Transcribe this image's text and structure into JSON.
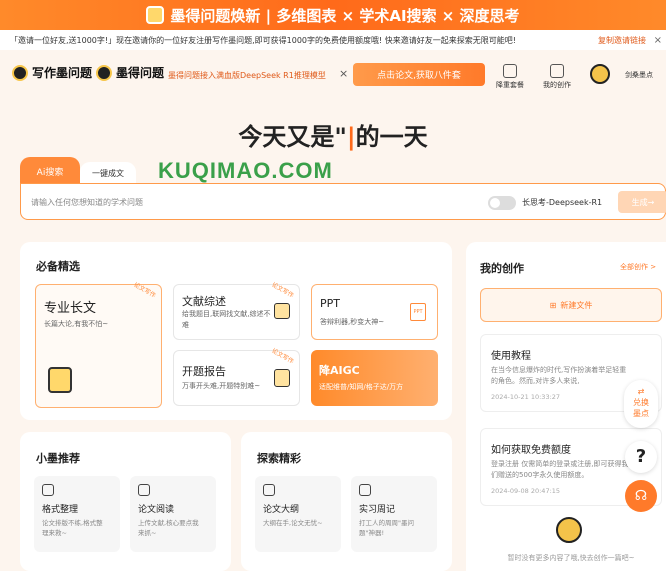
{
  "banner": {
    "text": "墨得问题焕新 | 多维图表 × 学术AI搜索 × 深度思考"
  },
  "invite": {
    "text": "「邀请一位好友,送1000字!」现在邀请你的一位好友注册写作墨问题,即可获得1000字的免费使用额度哦! 快来邀请好友一起来探索无限可能吧!",
    "copy_label": "复制邀请链接",
    "close": "×"
  },
  "header": {
    "logo": "写作墨问题",
    "logo2": "墨得问题",
    "notice": "墨得问题接入满血版DeepSeek R1推理模型",
    "notice_close": "×",
    "cta": "点击论文,获取八件套",
    "nav": [
      "降重套餐",
      "我的创作"
    ],
    "user": "剑桑墨点"
  },
  "hero": {
    "prefix": "今天又是\"",
    "cursor": "|",
    "suffix": "的一天"
  },
  "search": {
    "tab_active": "Ai搜索",
    "tab2": "一键成文",
    "watermark": "KUQIMAO.COM",
    "placeholder": "请输入任何您想知道的学术问题",
    "model": "长思考-Deepseek-R1",
    "generate": "生成→"
  },
  "essentials": {
    "title": "必备精选",
    "cards": [
      {
        "title": "专业长文",
        "sub": "长篇大论,有我不怕~",
        "badge": "论文写作"
      },
      {
        "title": "文献综述",
        "sub": "给我题目,联网找文献,综述不难",
        "badge": "论文写作"
      },
      {
        "title": "PPT",
        "sub": "答辩利器,秒变大神~",
        "badge": ""
      },
      {
        "title": "开题报告",
        "sub": "万事开头难,开题特别难~",
        "badge": "论文写作"
      },
      {
        "title": "降AIGC",
        "sub": "适配维普/知网/格子达/万方",
        "badge": ""
      }
    ]
  },
  "recommend": {
    "title": "小墨推荐",
    "items": [
      {
        "title": "格式整理",
        "sub": "论文排版不练,格式整理来救~"
      },
      {
        "title": "论文阅读",
        "sub": "上传文献,核心要点我来抓~"
      }
    ]
  },
  "explore": {
    "title": "探索精彩",
    "items": [
      {
        "title": "论文大纲",
        "sub": "大纲在手,论文无忧~"
      },
      {
        "title": "实习周记",
        "sub": "打工人的周周\"墨问题\"神器!"
      }
    ]
  },
  "mywork": {
    "title": "我的创作",
    "all": "全部创作 >",
    "new_file": "新建文件",
    "empty": "暂时没有更多内容了哦,快去创作一篇吧~"
  },
  "features": [
    {
      "title": "使用教程",
      "sub": "在当今信息爆炸的时代,写作扮演着举足轻重的角色。然而,对许多人来说,",
      "date": "2024-10-21 10:33:27"
    },
    {
      "title": "如何获取免费额度",
      "sub": "登录注册 仅需简单的登录或注册,即可获得我们赠送的500字永久使用额度。",
      "date": "2024-09-08 20:47:15"
    }
  ],
  "floats": {
    "exchange": "兑换墨点",
    "help": "?"
  },
  "colors": {
    "accent": "#ff7a2a",
    "bg": "#fdf5ee",
    "green": "#3aa04a"
  }
}
